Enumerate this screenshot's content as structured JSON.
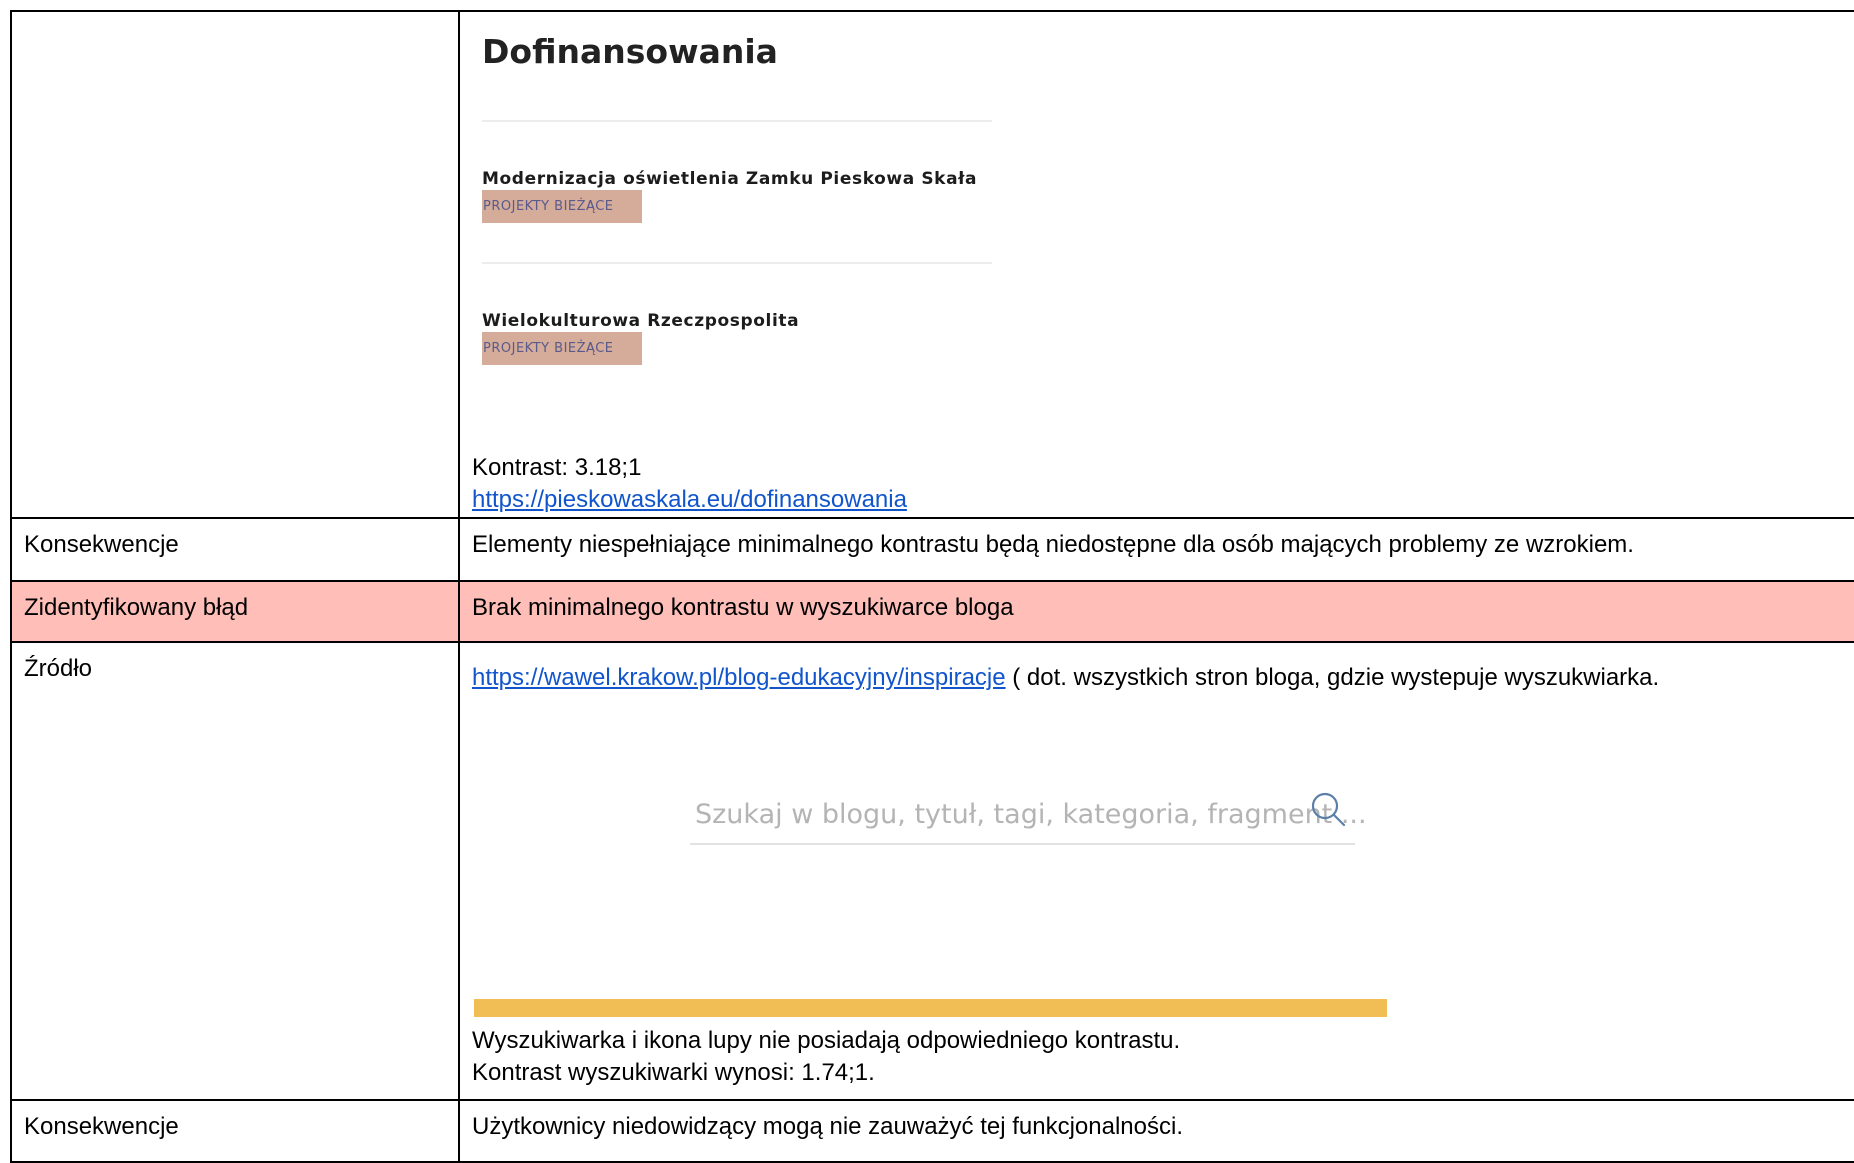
{
  "row1": {
    "screenshot": {
      "title": "Dofinansowania",
      "projects": [
        {
          "name": "Modernizacja oświetlenia Zamku Pieskowa Skała",
          "tag": "PROJEKTY BIEŻĄCE"
        },
        {
          "name": "Wielokulturowa Rzeczpospolita",
          "tag": "PROJEKTY BIEŻĄCE"
        }
      ]
    },
    "contrast": "Kontrast: 3.18;1",
    "link": "https://pieskowaskala.eu/dofinansowania"
  },
  "row2": {
    "label": "Konsekwencje",
    "text": "Elementy niespełniające minimalnego kontrastu będą niedostępne dla osób mających problemy ze wzrokiem."
  },
  "row3": {
    "label": "Zidentyfikowany błąd",
    "text": "Brak minimalnego kontrastu w wyszukiwarce bloga"
  },
  "row4": {
    "label": "Źródło",
    "link": "https://wawel.krakow.pl/blog-edukacyjny/inspiracje",
    "link_suffix": " ( dot. wszystkich stron bloga, gdzie wystepuje wyszukwiarka.",
    "search": {
      "placeholder": "Szukaj w blogu, tytuł, tagi, kategoria, fragment ...",
      "icon": "search-icon"
    },
    "note_line1": "Wyszukiwarka i ikona lupy nie posiadają odpowiedniego kontrastu.",
    "note_line2": "Kontrast wyszukiwarki wynosi: 1.74;1."
  },
  "row5": {
    "label": "Konsekwencje",
    "text": "Użytkownicy niedowidzący mogą nie zauważyć tej funkcjonalności."
  },
  "colors": {
    "error_row": "#ffbfb8",
    "tag_bg": "#d5ab99",
    "tag_text": "#5a5a8c",
    "link": "#1155cc",
    "highlight_bar": "#f1bd55",
    "search_placeholder": "#b4b4b4",
    "search_icon": "#5b7fa9"
  }
}
